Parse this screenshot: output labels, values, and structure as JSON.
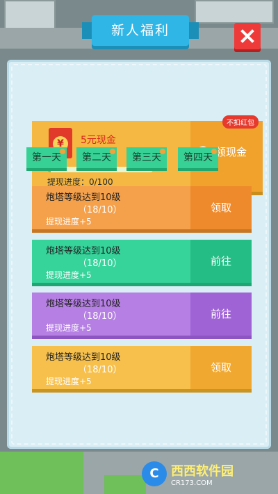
{
  "header": {
    "title": "新人福利"
  },
  "reward": {
    "title": "5元现金",
    "badge": "不扣红包",
    "claim_label": "领现金",
    "progress_text": "提现进度：0/100",
    "progress_value": 0
  },
  "days": [
    {
      "label": "第一天"
    },
    {
      "label": "第二天"
    },
    {
      "label": "第三天"
    },
    {
      "label": "第四天"
    }
  ],
  "tasks": [
    {
      "name": "炮塔等级达到10级",
      "count": "（18/10）",
      "reward": "提现进度+5",
      "button": "领取"
    },
    {
      "name": "炮塔等级达到10级",
      "count": "（18/10）",
      "reward": "提现进度+5",
      "button": "前往"
    },
    {
      "name": "炮塔等级达到10级",
      "count": "（18/10）",
      "reward": "提现进度+5",
      "button": "前往"
    },
    {
      "name": "炮塔等级达到10级",
      "count": "（18/10）",
      "reward": "提现进度+5",
      "button": "领取"
    }
  ],
  "icons": {
    "close": "close-icon",
    "red_packet": "red-packet-icon",
    "wechat": "wechat-icon"
  },
  "watermark": {
    "brand": "西西软件园",
    "sub": "CR173.COM"
  }
}
